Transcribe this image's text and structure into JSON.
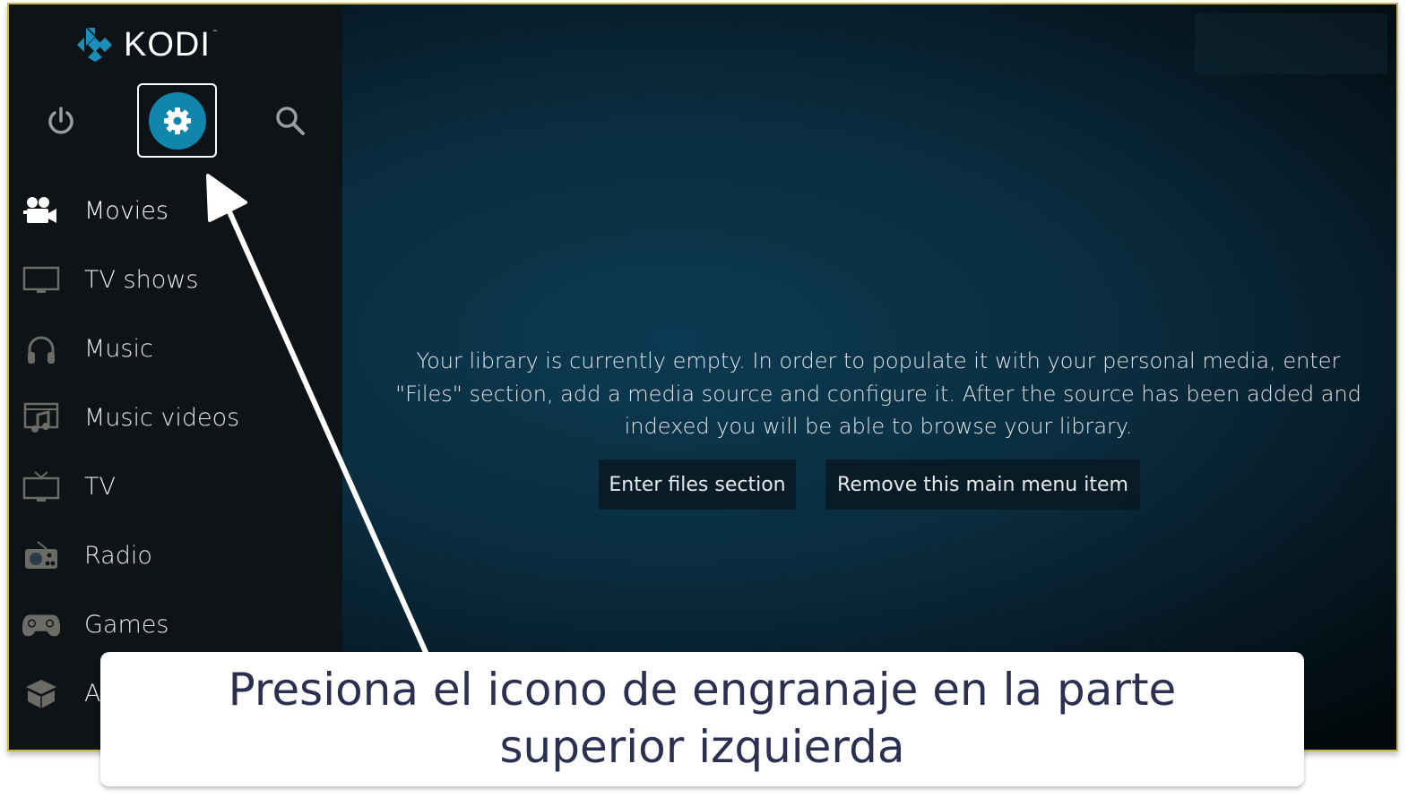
{
  "app": {
    "name": "KODI",
    "brand_color": "#1086ad"
  },
  "top_bar": {
    "buttons": [
      {
        "name": "power",
        "icon": "power-icon",
        "selected": false
      },
      {
        "name": "settings",
        "icon": "gear-icon",
        "selected": true
      },
      {
        "name": "search",
        "icon": "search-icon",
        "selected": false
      }
    ]
  },
  "sidebar": {
    "items": [
      {
        "label": "Movies",
        "icon": "movie-camera-icon",
        "active": true
      },
      {
        "label": "TV shows",
        "icon": "monitor-icon",
        "active": false
      },
      {
        "label": "Music",
        "icon": "headphones-icon",
        "active": false
      },
      {
        "label": "Music videos",
        "icon": "music-video-icon",
        "active": false
      },
      {
        "label": "TV",
        "icon": "tv-antenna-icon",
        "active": false
      },
      {
        "label": "Radio",
        "icon": "radio-icon",
        "active": false
      },
      {
        "label": "Games",
        "icon": "gamepad-icon",
        "active": false
      },
      {
        "label": "A",
        "icon": "addons-box-icon",
        "active": false
      }
    ]
  },
  "main": {
    "empty_message_lines": [
      "Your library is currently empty. In order to populate it with your personal media, enter",
      "\"Files\" section, add a media source and configure it. After the source has been added and",
      "indexed you will be able to browse your library."
    ],
    "buttons": {
      "enter_files": "Enter files section",
      "remove_item": "Remove this main menu item"
    }
  },
  "annotation": {
    "caption_lines": [
      "Presiona el icono de engranaje en la parte",
      "superior izquierda"
    ],
    "caption_color": "#2c3050"
  }
}
